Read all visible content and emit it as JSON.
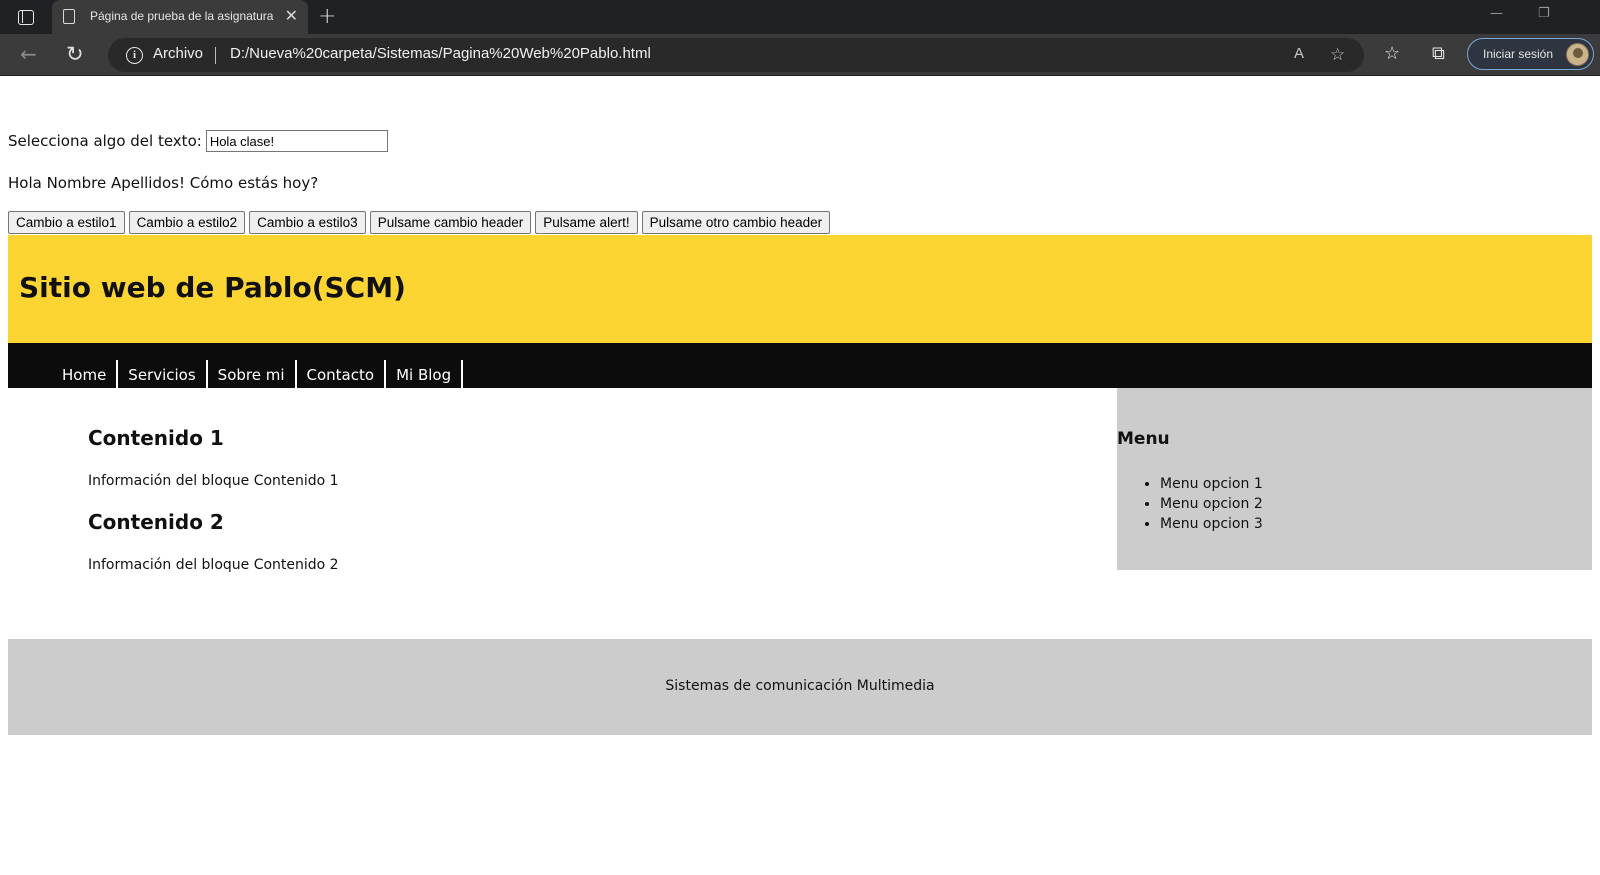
{
  "browser": {
    "tab_title": "Página de prueba de la asignatura",
    "tab_close_glyph": "✕",
    "new_tab_glyph": "+",
    "minimize_glyph": "—",
    "restore_glyph": "❐",
    "back_glyph": "←",
    "reload_glyph": "↻",
    "scheme_label": "Archivo",
    "url": "D:/Nueva%20carpeta/Sistemas/Pagina%20Web%20Pablo.html",
    "read_aloud_glyph": "A",
    "favorite_add_glyph": "☆",
    "favorites_glyph": "☆",
    "collections_glyph": "⧉",
    "signin_label": "Iniciar sesión",
    "icons": [
      "tab-actions-icon",
      "page-icon",
      "close-icon",
      "plus-icon",
      "back-arrow-icon",
      "reload-icon",
      "info-icon",
      "read-aloud-icon",
      "star-add-icon",
      "favorites-icon",
      "collections-icon",
      "avatar"
    ]
  },
  "page": {
    "select_label": "Selecciona algo del texto:",
    "select_value": "Hola clase!",
    "greeting": "Hola Nombre Apellidos! Cómo estás hoy?",
    "buttons": [
      "Cambio a estilo1",
      "Cambio a estilo2",
      "Cambio a estilo3",
      "Pulsame cambio header",
      "Pulsame alert!",
      "Pulsame otro cambio header"
    ],
    "header_title": "Sitio web de Pablo(SCM)",
    "nav": [
      "Home",
      "Servicios",
      "Sobre mi",
      "Contacto",
      "Mi Blog"
    ],
    "content": [
      {
        "title": "Contenido 1",
        "text": "Información del bloque Contenido 1"
      },
      {
        "title": "Contenido 2",
        "text": "Información del bloque Contenido 2"
      }
    ],
    "aside": {
      "title": "Menu",
      "items": [
        "Menu opcion 1",
        "Menu opcion 2",
        "Menu opcion 3"
      ]
    },
    "footer": "Sistemas de comunicación Multimedia"
  },
  "colors": {
    "header_bg": "#fdd533",
    "nav_bg": "#0c0c0c",
    "aside_bg": "#cccccc",
    "footer_bg": "#cccccc",
    "chrome_bg": "#202124"
  }
}
